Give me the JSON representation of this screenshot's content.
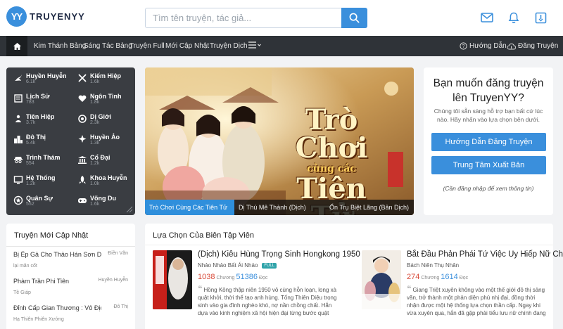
{
  "header": {
    "logo_badge": "YY",
    "logo_text": "TRUYENYY",
    "search_placeholder": "Tìm tên truyện, tác giả..."
  },
  "nav": {
    "items": [
      "Kim Thánh Bảng",
      "Sáng Tác Bảng",
      "Truyện Full",
      "Mới Cập Nhật",
      "Truyện Dịch"
    ],
    "guide": "Hướng Dẫn",
    "publish": "Đăng Truyện"
  },
  "genres": [
    {
      "name": "Huyền Huyễn",
      "count": "6.1k",
      "icon": "dragon-icon"
    },
    {
      "name": "Kiếm Hiệp",
      "count": "1.6k",
      "icon": "swords-icon"
    },
    {
      "name": "Lịch Sử",
      "count": "783",
      "icon": "history-book-icon"
    },
    {
      "name": "Ngôn Tình",
      "count": "1.8k",
      "icon": "heart-icon"
    },
    {
      "name": "Tiên Hiệp",
      "count": "3.7k",
      "icon": "immortal-icon"
    },
    {
      "name": "Dị Giới",
      "count": "2.3k",
      "icon": "portal-icon"
    },
    {
      "name": "Đô Thị",
      "count": "5.4k",
      "icon": "city-icon"
    },
    {
      "name": "Huyền Ảo",
      "count": "1.3k",
      "icon": "magic-icon"
    },
    {
      "name": "Trinh Thám",
      "count": "554",
      "icon": "detective-icon"
    },
    {
      "name": "Cổ Đại",
      "count": "1.2k",
      "icon": "ancient-icon"
    },
    {
      "name": "Hệ Thống",
      "count": "1.2k",
      "icon": "system-icon"
    },
    {
      "name": "Khoa Huyễn",
      "count": "1.0k",
      "icon": "scifi-icon"
    },
    {
      "name": "Quân Sự",
      "count": "552",
      "icon": "military-icon"
    },
    {
      "name": "Võng Du",
      "count": "1.6k",
      "icon": "gamepad-icon"
    }
  ],
  "banner": {
    "title_1": "Trò Chơi",
    "title_2": "cùng các",
    "title_3": "Tiên Tử",
    "captions": [
      "Trò Chơi Cùng Các Tiên Tử",
      "Dị Thú Mê Thành (Dịch)",
      "Ổn Trụ Biệt Lãng (Bản Dịch)"
    ]
  },
  "promo": {
    "heading": "Bạn muốn đăng truyện lên TruyenYY?",
    "body": "Chúng tôi sẵn sàng hỗ trợ bạn bất cứ lúc nào. Hãy nhấn vào lựa chọn bên dưới.",
    "btn_guide": "Hướng Dẫn Đăng Truyện",
    "btn_publish": "Trung Tâm Xuất Bản",
    "note": "(Cần đăng nhập để xem thông tin)"
  },
  "latest": {
    "title": "Truyện Mới Cập Nhật",
    "items": [
      {
        "title": "Bị Ép Gả Cho Thảo Hán Sơn Dã, ...",
        "category": "Điền Văn",
        "author": "lại mãn cốt"
      },
      {
        "title": "Phàm Trần Phi Tiên",
        "category": "Huyền Huyễn",
        "author": "Tề Giáp"
      },
      {
        "title": "Đỉnh Cấp Gian Thương : Vô Địch T...",
        "category": "Đô Thị",
        "author": "Hạ Thiên Phiên Xướng"
      }
    ]
  },
  "picks": {
    "title": "Lựa Chọn Của Biên Tập Viên",
    "books": [
      {
        "title": "(Dịch) Kiêu Hùng Trọng Sinh Hongkong 1950",
        "author": "Nhảo Nhảo Bất Ái Nhảo",
        "badge": "FULL",
        "chapters": "1038",
        "chapters_label": "Chương",
        "views": "51386",
        "views_label": "Đọc",
        "desc": "Hồng Kông thập niên 1950 vô cùng hỗn loạn, long xà quật khởi, thời thế tạo anh hùng. Tống Thiên Diệu trọng sinh vào gia đình nghèo khó, nợ nần chồng chất. Hắn dựa vào kinh nghiệm xã hội hiện đại từng bước quật khởi trở thành ông trùm của hắc bạch lưỡng đạo. Tất cả"
      },
      {
        "title": "Bắt Đầu Phản Phái Tứ Việc Uy Hiếp Nữ Chính",
        "author": "Bách Niên Thụ Nhân",
        "badge": "",
        "chapters": "274",
        "chapters_label": "Chương",
        "views": "1614",
        "views_label": "Đọc",
        "desc": "Giang Triệt xuyên không vào một thế giới đô thị sảng văn, trở thành một phản diện phú nhị đại, đồng thời nhận được một hệ thống lựa chọn thần cấp. Ngay khi vừa xuyên qua, hắn đã gặp phải tiểu lưu nữ chính đang trốn bài thi! Từ đó, hệ thống phản diện bắt đầu hoạt động!"
      }
    ]
  },
  "colors": {
    "accent": "#3a8fdc",
    "nav_bg": "#2f3338",
    "panel_bg": "#3a3d42",
    "page_bg": "#f2f3f5"
  }
}
